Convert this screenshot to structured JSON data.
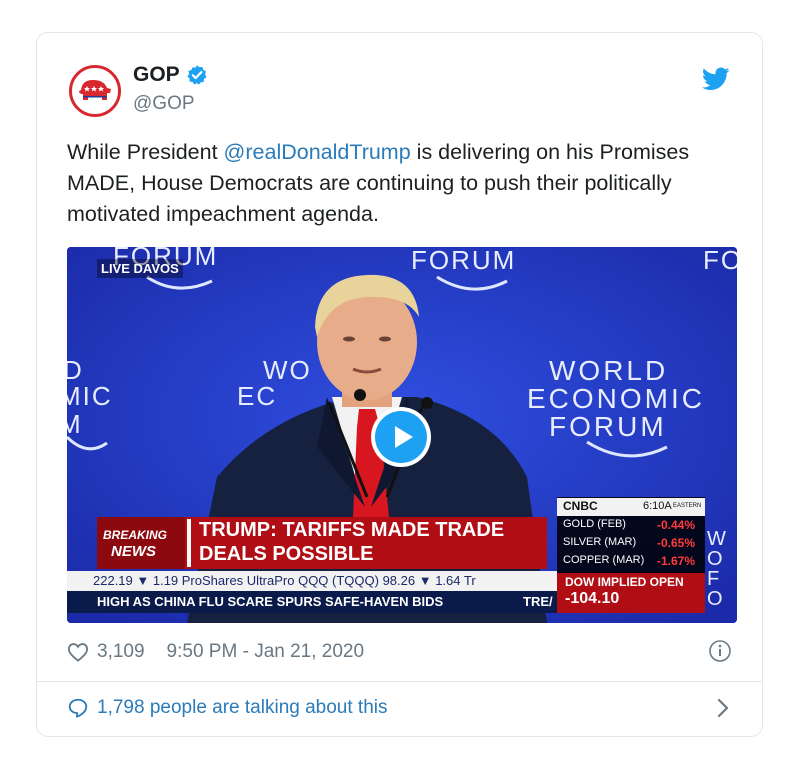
{
  "tweet": {
    "author_name": "GOP",
    "handle": "@GOP",
    "text_before": "While President ",
    "mention": "@realDonaldTrump",
    "text_after": " is delivering on his Promises MADE, House Democrats are continuing to push their politically motivated impeachment agenda.",
    "likes": "3,109",
    "timestamp": "9:50 PM - Jan 21, 2020",
    "talking": "1,798 people are talking about this"
  },
  "video": {
    "forum_top_left": "FORUM",
    "forum_top_center": "FORUM",
    "forum_top_right": "FO",
    "live_tag": "LIVE DAVOS",
    "left_edge_line1": "D",
    "left_edge_line2": "MIC",
    "left_edge_line3": "M",
    "center_line1": "WO",
    "center_line2": "EC",
    "wef_line1": "WORLD",
    "wef_line2": "ECONOMIC",
    "wef_line3": "FORUM",
    "breaking_line1": "BREAKING",
    "breaking_line2": "NEWS",
    "headline_line1": "TRUMP: TARIFFS MADE TRADE",
    "headline_line2": "DEALS POSSIBLE",
    "cnbc_logo": "CNBC",
    "cnbc_time": "6:10A",
    "cnbc_zone": "EASTERN",
    "commodities": [
      {
        "name": "GOLD (FEB)",
        "change": "-0.44%"
      },
      {
        "name": "SILVER (MAR)",
        "change": "-0.65%"
      },
      {
        "name": "COPPER (MAR)",
        "change": "-1.67%"
      }
    ],
    "ticker_line": "222.19 ▼ 1.19   ProShares UltraPro QQQ (TQQQ) 98.26 ▼ 1.64   Tr",
    "crawl_line": "HIGH AS CHINA FLU SCARE SPURS SAFE-HAVEN BIDS",
    "crawl_tail": "TRE/",
    "dow_label": "DOW IMPLIED OPEN",
    "dow_value": "-104.10",
    "right_edge": "WOFO"
  },
  "colors": {
    "link": "#2b7bb9",
    "twitter_blue": "#1da1f2",
    "gop_red": "#d7282f",
    "stage_blue": "#1f33b8"
  },
  "icons": {
    "verified": "verified-badge-icon",
    "twitter": "twitter-bird-icon",
    "heart": "heart-icon",
    "info": "info-icon",
    "comment": "comment-bubble-icon",
    "chevron": "chevron-right-icon",
    "play": "play-icon",
    "logo": "gop-elephant-icon"
  }
}
